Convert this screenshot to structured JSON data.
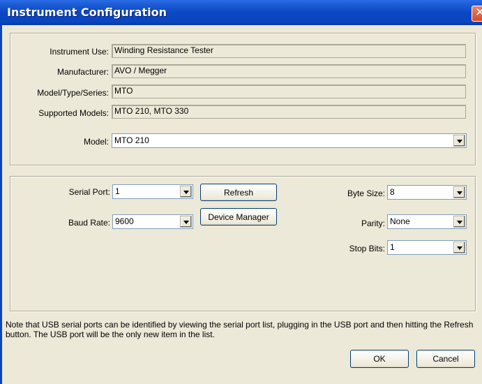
{
  "window": {
    "title": "Instrument Configuration"
  },
  "instrument": {
    "use_label": "Instrument Use:",
    "use_value": "Winding Resistance Tester",
    "manufacturer_label": "Manufacturer:",
    "manufacturer_value": "AVO / Megger",
    "model_type_label": "Model/Type/Series:",
    "model_type_value": "MTO",
    "supported_label": "Supported Models:",
    "supported_value": "MTO 210, MTO 330",
    "model_label": "Model:",
    "model_value": "MTO 210"
  },
  "serial": {
    "port_label": "Serial Port:",
    "port_value": "1",
    "baud_label": "Baud Rate:",
    "baud_value": "9600",
    "refresh_button": "Refresh",
    "device_manager_button": "Device Manager",
    "byte_size_label": "Byte Size:",
    "byte_size_value": "8",
    "parity_label": "Parity:",
    "parity_value": "None",
    "stop_bits_label": "Stop Bits:",
    "stop_bits_value": "1"
  },
  "note": "Note that USB serial ports can be identified by viewing the serial port list, plugging in the USB port and then hitting the Refresh button.  The USB port will be the only new item in the list.",
  "buttons": {
    "ok": "OK",
    "cancel": "Cancel"
  },
  "icons": {
    "close": "close-icon",
    "dropdown": "chevron-down-icon"
  }
}
